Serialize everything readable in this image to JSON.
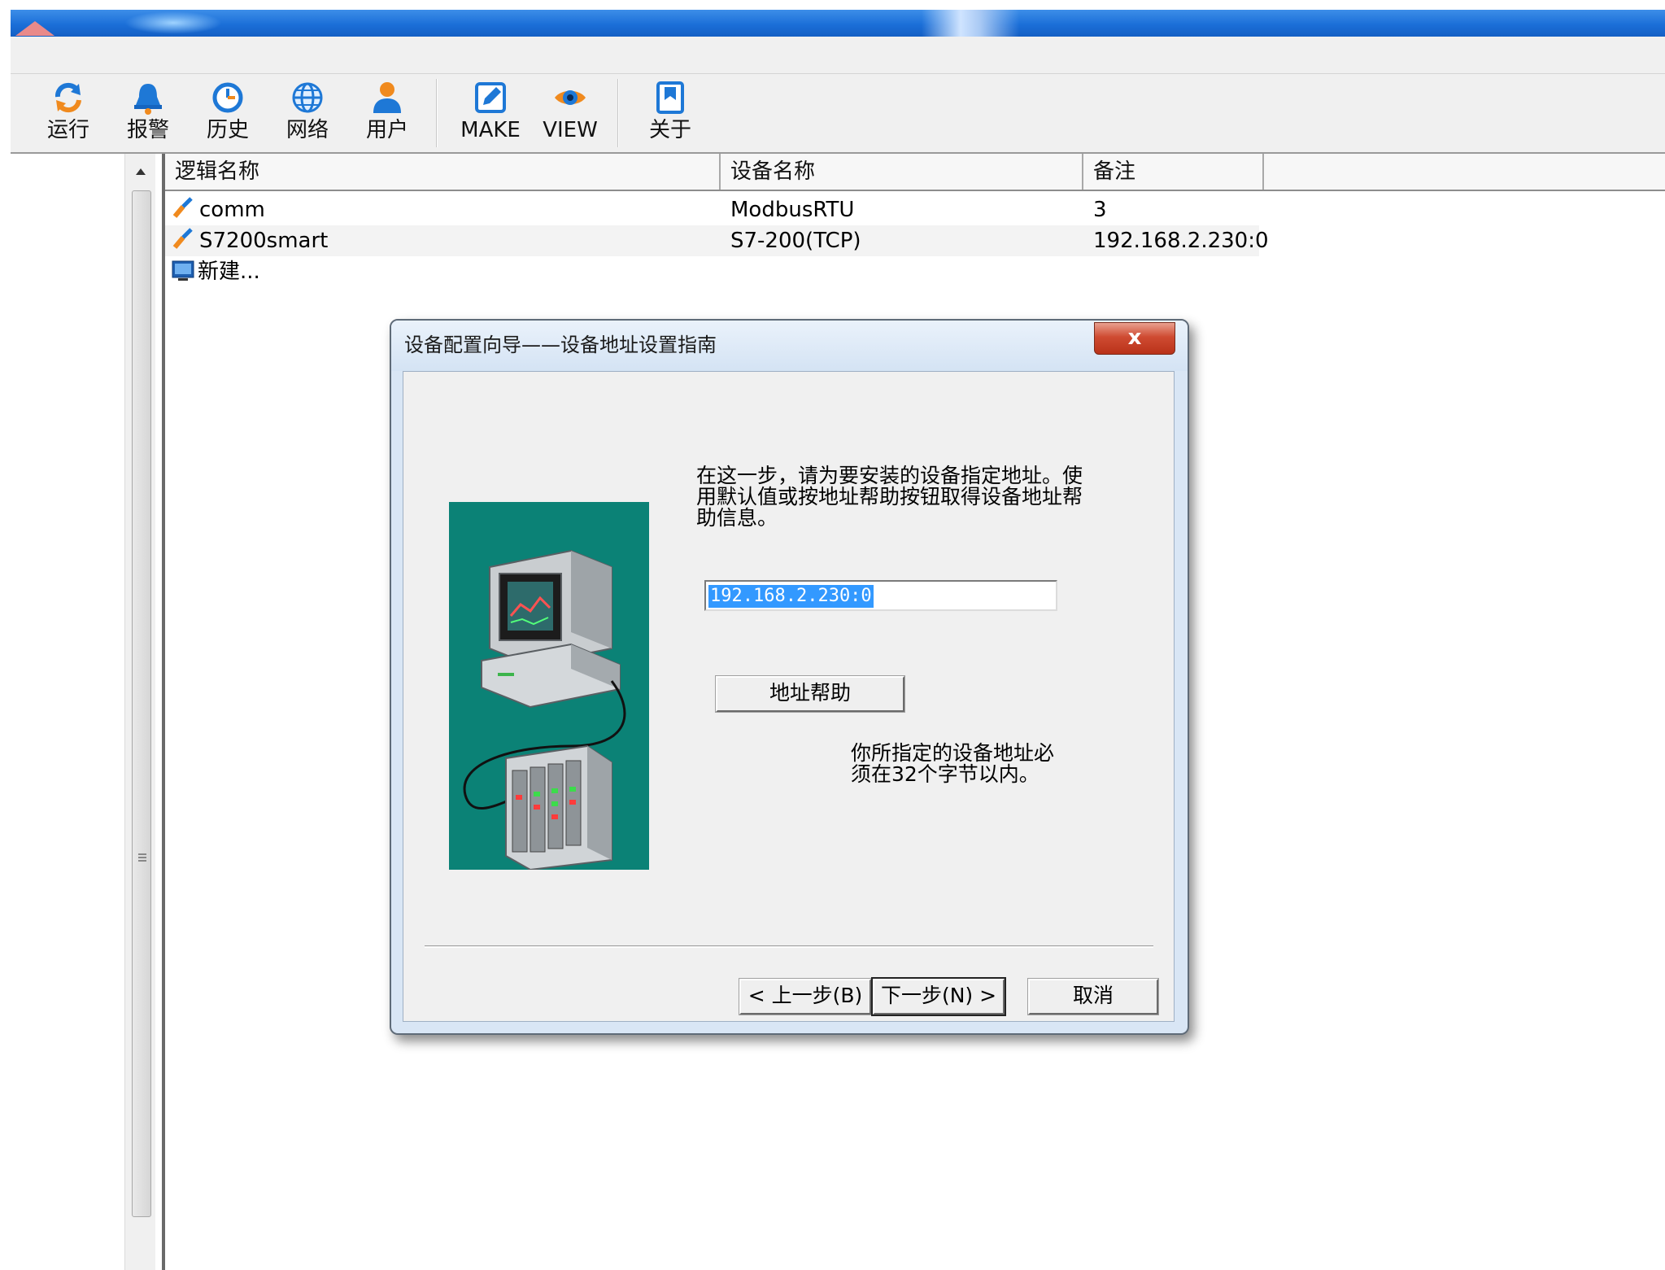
{
  "toolbar": {
    "buttons": [
      {
        "label": "运行",
        "icon": "run-icon"
      },
      {
        "label": "报警",
        "icon": "alarm-bell-icon"
      },
      {
        "label": "历史",
        "icon": "history-clock-icon"
      },
      {
        "label": "网络",
        "icon": "network-globe-icon"
      },
      {
        "label": "用户",
        "icon": "user-icon"
      },
      {
        "label": "MAKE",
        "icon": "make-edit-icon"
      },
      {
        "label": "VIEW",
        "icon": "view-eye-icon"
      },
      {
        "label": "关于",
        "icon": "about-book-icon"
      }
    ]
  },
  "table": {
    "columns": [
      "逻辑名称",
      "设备名称",
      "备注"
    ],
    "rows": [
      {
        "logical_name": "comm",
        "device": "ModbusRTU",
        "note": "3"
      },
      {
        "logical_name": "S7200smart",
        "device": "S7-200(TCP)",
        "note": "192.168.2.230:0"
      },
      {
        "logical_name": "新建...",
        "device": "",
        "note": ""
      }
    ]
  },
  "dialog": {
    "title": "设备配置向导——设备地址设置指南",
    "close_label": "x",
    "instruction": "在这一步，请为要安装的设备指定地址。使用默认值或按地址帮助按钮取得设备地址帮助信息。",
    "address_value": "192.168.2.230:0",
    "address_help_label": "地址帮助",
    "note": "你所指定的设备地址必须在32个字节以内。",
    "prev_label": "< 上一步(B)",
    "next_label": "下一步(N) >",
    "cancel_label": "取消"
  },
  "colors": {
    "titlebar": "#1b6fd8",
    "illustration_bg": "#0b8276",
    "selection": "#3399ff",
    "close_button": "#cf4b32"
  }
}
